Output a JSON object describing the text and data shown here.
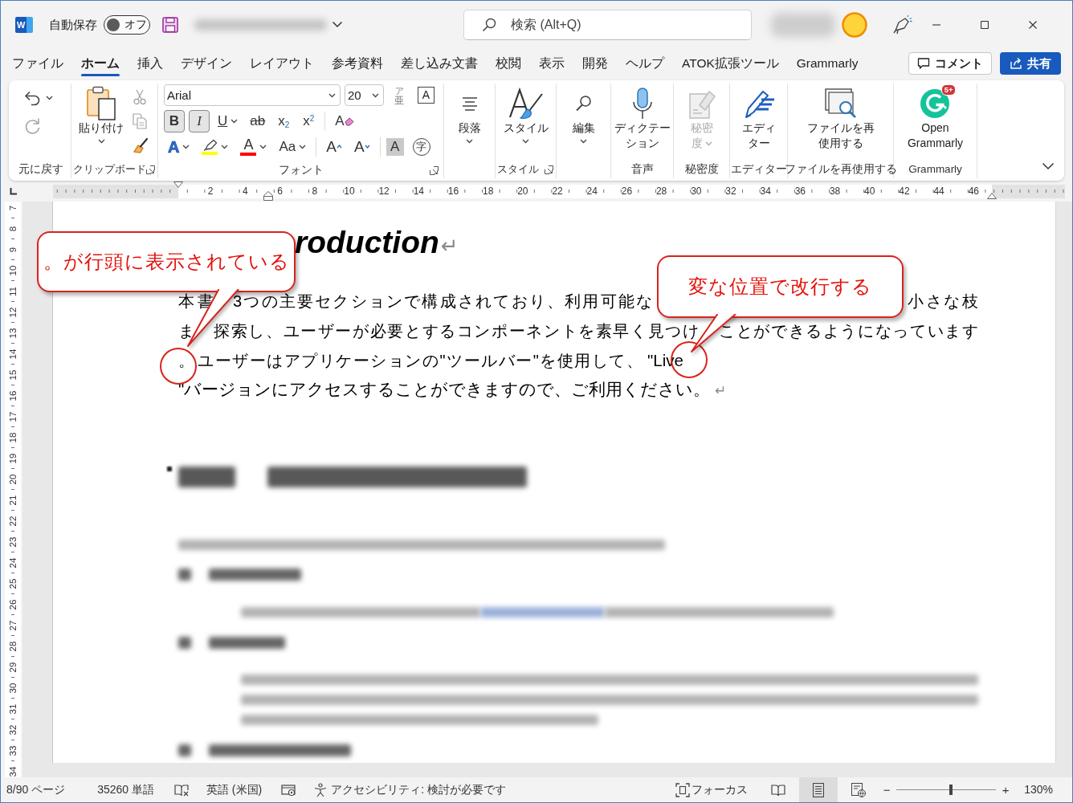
{
  "title_bar": {
    "logo_letter": "W",
    "autosave": {
      "label": "自動保存",
      "on": false,
      "state_label": "オフ"
    },
    "search": {
      "placeholder": "検索 (Alt+Q)"
    }
  },
  "tabs": [
    {
      "label": "ファイル",
      "selected": false
    },
    {
      "label": "ホーム",
      "selected": true
    },
    {
      "label": "挿入",
      "selected": false
    },
    {
      "label": "デザイン",
      "selected": false
    },
    {
      "label": "レイアウト",
      "selected": false
    },
    {
      "label": "参考資料",
      "selected": false
    },
    {
      "label": "差し込み文書",
      "selected": false
    },
    {
      "label": "校閲",
      "selected": false
    },
    {
      "label": "表示",
      "selected": false
    },
    {
      "label": "開発",
      "selected": false
    },
    {
      "label": "ヘルプ",
      "selected": false
    },
    {
      "label": "ATOK拡張ツール",
      "selected": false
    },
    {
      "label": "Grammarly",
      "selected": false
    }
  ],
  "header_buttons": [
    {
      "kind": "comment",
      "label": "コメント"
    },
    {
      "kind": "share",
      "label": "共有"
    }
  ],
  "ribbon": {
    "groups": [
      {
        "kind": "undo",
        "label": "元に戻す",
        "actions": [
          {
            "kind": "undo",
            "disabled": false,
            "dropdown": true
          },
          {
            "kind": "redo",
            "disabled": true,
            "dropdown": false
          }
        ]
      },
      {
        "kind": "clipboard",
        "label": "クリップボード",
        "button": [
          "貼り付け"
        ],
        "disabled": false,
        "tools": [
          {
            "kind": "cut",
            "disabled": true
          },
          {
            "kind": "copy",
            "disabled": true
          },
          {
            "kind": "format_painter",
            "disabled": false
          }
        ]
      },
      {
        "kind": "font",
        "label": "フォント",
        "font_name": "Arial",
        "font_size": "20",
        "phonetic_guide": [
          "ア",
          "亜"
        ],
        "border_glyph": "A",
        "format_buttons": [
          {
            "kind": "bold",
            "glyph": "B",
            "selected": true,
            "dropdown": false
          },
          {
            "kind": "italic",
            "glyph": "I",
            "selected": true,
            "dropdown": false
          },
          {
            "kind": "underline",
            "glyph": "U",
            "selected": false,
            "dropdown": true
          },
          {
            "kind": "strikethrough",
            "glyph": "ab",
            "selected": false,
            "dropdown": false
          },
          {
            "kind": "subscript",
            "glyph": "x$_{2}$",
            "selected": false,
            "dropdown": false
          },
          {
            "kind": "superscript",
            "glyph": "x$^{2}$",
            "selected": false,
            "dropdown": false
          }
        ],
        "clear_glyph": "A",
        "effect_buttons": [
          {
            "kind": "text_effects",
            "glyph": "A",
            "dropdown": true
          },
          {
            "kind": "highlight",
            "color": "#ffff00",
            "dropdown": true
          },
          {
            "kind": "font_color",
            "glyph": "A",
            "color": "#ff0000",
            "dropdown": true
          },
          {
            "kind": "change_case",
            "glyph": "Aa",
            "dropdown": true
          },
          {
            "kind": "grow",
            "glyph": "A",
            "dropdown": false
          },
          {
            "kind": "shrink",
            "glyph": "A",
            "dropdown": false
          },
          {
            "kind": "shading",
            "glyph": "A",
            "dropdown": false
          },
          {
            "kind": "enclose",
            "glyph": "字",
            "dropdown": false
          }
        ]
      },
      {
        "kind": "paragraph",
        "button": [
          "段落"
        ],
        "disabled": false
      },
      {
        "kind": "styles",
        "label": "スタイル",
        "button": [
          "スタイル"
        ],
        "disabled": false
      },
      {
        "kind": "editing",
        "button": [
          "編集"
        ],
        "disabled": false
      },
      {
        "kind": "dictation",
        "label": "音声",
        "button": [
          "ディクテー",
          "ション"
        ],
        "disabled": false
      },
      {
        "kind": "sensitivity",
        "label": "秘密度",
        "button": [
          "秘密",
          "度"
        ],
        "disabled": true
      },
      {
        "kind": "editor",
        "label": "エディター",
        "button": [
          "エディ",
          "ター"
        ],
        "disabled": false
      },
      {
        "kind": "reuse",
        "label": "ファイルを再使用する",
        "button": [
          "ファイルを再",
          "使用する"
        ],
        "disabled": false
      },
      {
        "kind": "grammarly",
        "label": "Grammarly",
        "button": [
          "Open",
          "Grammarly"
        ],
        "badge": "5+",
        "disabled": false
      }
    ]
  },
  "ruler": {
    "horizontal_numbers": [
      "2",
      "4",
      "6",
      "8",
      "10",
      "12",
      "14",
      "16",
      "18",
      "20",
      "22",
      "24",
      "26",
      "28",
      "30",
      "32",
      "34",
      "36",
      "38",
      "40",
      "42",
      "44",
      "46"
    ],
    "vertical_numbers": [
      "7",
      "8",
      "9",
      "10",
      "11",
      "12",
      "13",
      "14",
      "15",
      "16",
      "17",
      "18",
      "19",
      "20",
      "21",
      "22",
      "23",
      "24",
      "25",
      "26",
      "27",
      "28",
      "29",
      "30",
      "31",
      "32",
      "33",
      "34"
    ]
  },
  "document": {
    "heading": {
      "text": "roduction",
      "end_mark": "↵"
    },
    "paragraph": {
      "lines": [
        {
          "segments": [
            {
              "text": "本書",
              "kind": "cjk",
              "circled": false
            },
            {
              "text": "3つの主要セクションで構成されており、利用可能な",
              "kind": "cjk",
              "circled": false
            },
            {
              "text": "小さな枝",
              "kind": "cjk",
              "circled": false
            }
          ]
        },
        {
          "segments": [
            {
              "text": "ま",
              "kind": "cjk",
              "circled": false
            },
            {
              "text": "探索し、ユーザーが必要とするコンポーネントを素早く見つけ",
              "kind": "cjk",
              "circled": false
            },
            {
              "text": "ことができるようになっています",
              "kind": "cjk",
              "circled": false
            }
          ]
        },
        {
          "segments": [
            {
              "text": "。",
              "kind": "cjk",
              "circled": true
            },
            {
              "text": "ユーザーはアプリケーションの\"ツールバー\"を使用して、",
              "kind": "cjk",
              "circled": false
            },
            {
              "text": "\"Live",
              "kind": "latin",
              "circled": true
            }
          ]
        },
        {
          "segments": [
            {
              "text": "\"バージョンにアクセスすることができますので、ご利用ください。",
              "kind": "cjk",
              "circled": false
            }
          ]
        }
      ],
      "end_mark": "↵"
    },
    "callouts": [
      {
        "text": "。が行頭に表示されている"
      },
      {
        "text": "変な位置で改行する"
      }
    ]
  },
  "status_bar": {
    "items": [
      {
        "kind": "text",
        "text": "8/90 ページ"
      },
      {
        "kind": "text",
        "text": "35260 単語"
      },
      {
        "kind": "proofing"
      },
      {
        "kind": "text",
        "text": "英語 (米国)"
      },
      {
        "kind": "predictions"
      },
      {
        "kind": "accessibility",
        "text": "アクセシビリティ: 検討が必要です"
      }
    ],
    "focus": "フォーカス",
    "views": [
      {
        "kind": "read",
        "selected": false
      },
      {
        "kind": "print",
        "selected": true
      },
      {
        "kind": "web",
        "selected": false
      }
    ],
    "zoom": {
      "minus": "−",
      "plus": "+",
      "level": 0.55,
      "reading": "130%"
    }
  }
}
